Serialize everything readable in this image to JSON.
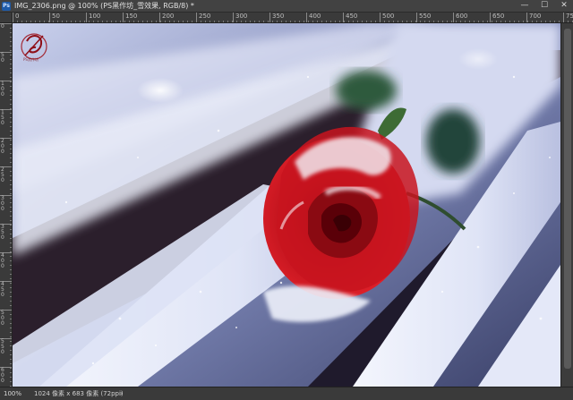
{
  "window": {
    "app_icon_text": "Ps",
    "title": "IMG_2306.png @ 100% (PS黑作坊_雪效果, RGB/8) *",
    "minimize_glyph": "—",
    "maximize_glyph": "☐",
    "close_glyph": "✕"
  },
  "ruler_h": {
    "labels": [
      "0",
      "50",
      "100",
      "150",
      "200",
      "250",
      "300",
      "350",
      "400",
      "450",
      "500",
      "550",
      "600",
      "650",
      "700",
      "750"
    ]
  },
  "ruler_v": {
    "labels": [
      "0",
      "50",
      "100",
      "150",
      "200",
      "250",
      "300",
      "350",
      "400",
      "450",
      "500",
      "550",
      "600",
      "650"
    ]
  },
  "canvas": {
    "watermark_text": "PS黑作坊",
    "content": "photo-snow-rose"
  },
  "status": {
    "zoom": "100%",
    "doc_info": "1024 像素 x 683 像素 (72ppi)",
    "arrow_glyph": "›"
  },
  "colors": {
    "chrome": "#424242",
    "ruler": "#3a3a3a",
    "rose_red": "#c8141e",
    "snow": "#e8ecf8",
    "shadow_navy": "#2a2f4a"
  }
}
